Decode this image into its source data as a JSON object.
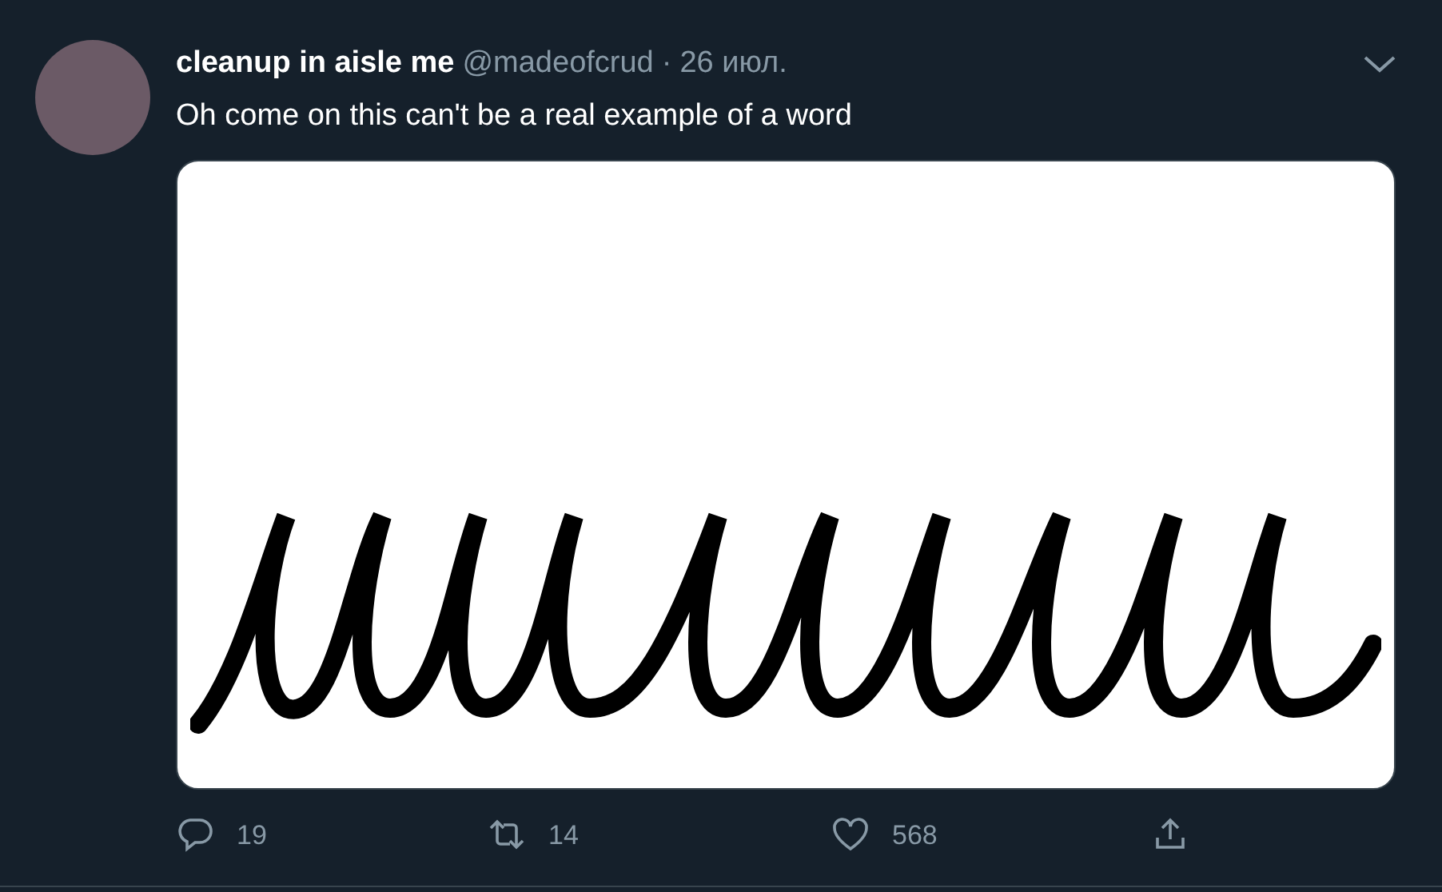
{
  "tweet": {
    "author_name": "cleanup in aisle me",
    "handle": "@madeofcrud",
    "separator": "·",
    "date": "26 июл.",
    "text": "Oh come on this can't be a real example of a word",
    "actions": [
      {
        "kind": "reply",
        "count": "19"
      },
      {
        "kind": "retweet",
        "count": "14"
      },
      {
        "kind": "like",
        "count": "568"
      },
      {
        "kind": "share"
      }
    ]
  }
}
